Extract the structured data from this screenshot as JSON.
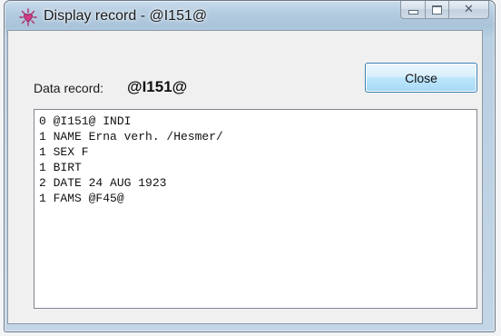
{
  "window": {
    "title": "Display record - @I151@",
    "icon": "heart-app-icon"
  },
  "caption_buttons": {
    "minimize_icon": "minimize-icon",
    "maximize_icon": "maximize-icon",
    "close_glyph": "✕"
  },
  "record": {
    "label": "Data record:",
    "id": "@I151@"
  },
  "buttons": {
    "close_label": "Close"
  },
  "record_lines": [
    "0 @I151@ INDI",
    "1 NAME Erna verh. /Hesmer/",
    "1 SEX F",
    "1 BIRT",
    "2 DATE 24 AUG 1923",
    "1 FAMS @F45@"
  ],
  "colors": {
    "title_bar": "#b3cbe0",
    "button_face": "#bee6fd",
    "button_border": "#3c7fb1"
  }
}
